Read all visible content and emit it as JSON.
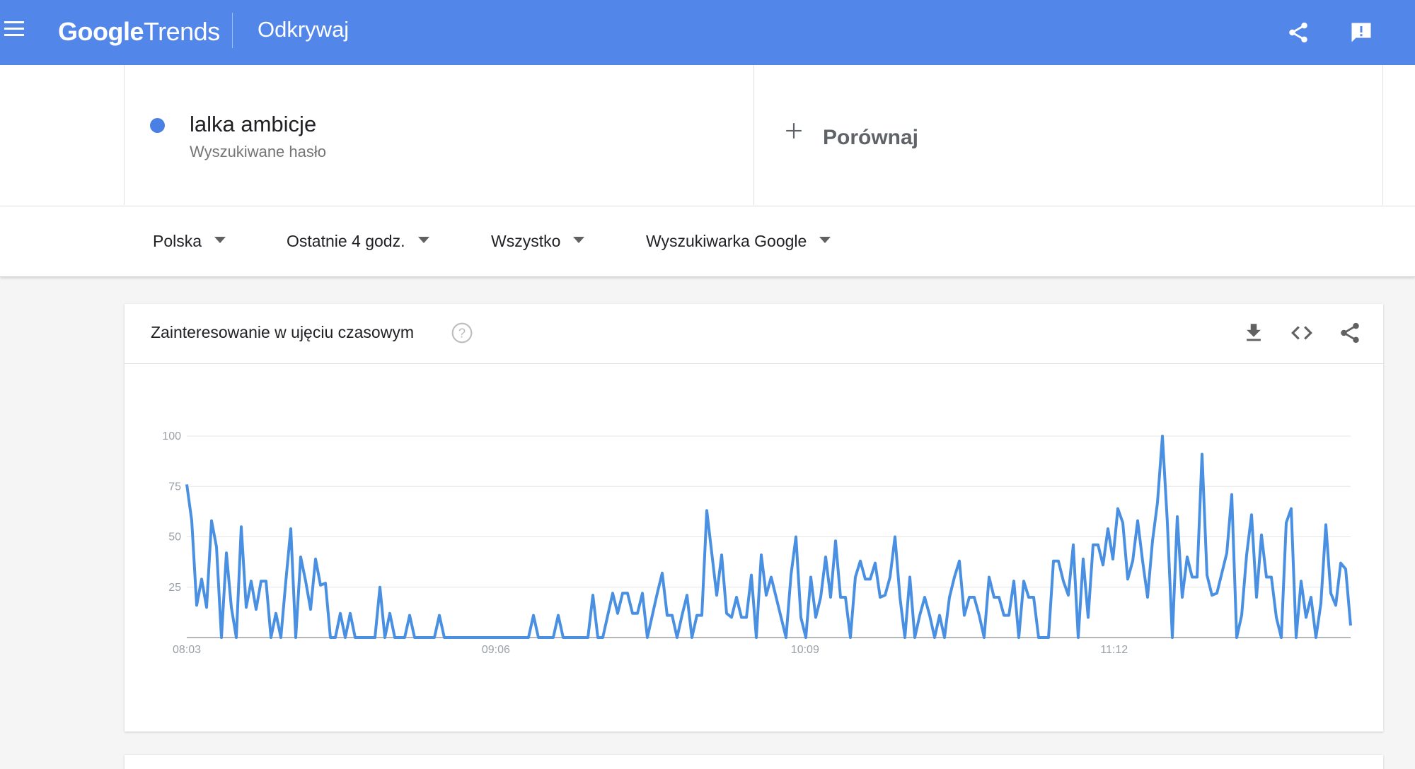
{
  "header": {
    "logo_google": "Google",
    "logo_trends": "Trends",
    "section": "Odkrywaj",
    "icons": [
      "menu-icon",
      "share-icon",
      "feedback-icon"
    ],
    "color": "#5287e9"
  },
  "term": {
    "name": "lalka ambicje",
    "type": "Wyszukiwane hasło",
    "color": "#4a7fe3"
  },
  "compare": {
    "label": "Porównaj"
  },
  "filters": {
    "region": "Polska",
    "time": "Ostatnie 4 godz.",
    "category": "Wszystko",
    "property": "Wyszukiwarka Google"
  },
  "chart_card": {
    "title": "Zainteresowanie w ujęciu czasowym",
    "tools": [
      "download-icon",
      "embed-code-icon",
      "share-icon"
    ]
  },
  "chart_data": {
    "type": "line",
    "x_labels": [
      "08:03",
      "09:06",
      "10:09",
      "11:12"
    ],
    "y_ticks": [
      25,
      50,
      75,
      100
    ],
    "ylim": [
      0,
      100
    ],
    "grid": true,
    "series": [
      {
        "color": "#4a90e2",
        "values": [
          76,
          58,
          16,
          29,
          15,
          58,
          45,
          0,
          42,
          15,
          0,
          55,
          15,
          28,
          14,
          28,
          28,
          0,
          12,
          0,
          28,
          54,
          0,
          40,
          28,
          14,
          39,
          26,
          27,
          0,
          0,
          12,
          0,
          12,
          0,
          0,
          0,
          0,
          0,
          25,
          0,
          12,
          0,
          0,
          0,
          11,
          0,
          0,
          0,
          0,
          0,
          11,
          0,
          0,
          0,
          0,
          0,
          0,
          0,
          0,
          0,
          0,
          0,
          0,
          0,
          0,
          0,
          0,
          0,
          0,
          11,
          0,
          0,
          0,
          0,
          11,
          0,
          0,
          0,
          0,
          0,
          0,
          21,
          0,
          0,
          11,
          22,
          12,
          22,
          22,
          12,
          12,
          22,
          0,
          11,
          22,
          32,
          11,
          11,
          0,
          11,
          21,
          0,
          11,
          11,
          63,
          42,
          21,
          41,
          12,
          10,
          20,
          10,
          10,
          31,
          0,
          41,
          21,
          30,
          20,
          10,
          0,
          31,
          50,
          10,
          0,
          30,
          10,
          20,
          40,
          20,
          48,
          20,
          20,
          0,
          30,
          38,
          29,
          29,
          37,
          20,
          21,
          30,
          50,
          20,
          0,
          30,
          0,
          11,
          20,
          11,
          0,
          11,
          0,
          20,
          30,
          38,
          11,
          20,
          20,
          11,
          0,
          30,
          20,
          20,
          11,
          11,
          28,
          0,
          28,
          20,
          20,
          0,
          0,
          0,
          38,
          38,
          28,
          21,
          46,
          0,
          39,
          10,
          46,
          46,
          36,
          54,
          39,
          64,
          57,
          29,
          38,
          58,
          38,
          20,
          48,
          67,
          100,
          57,
          0,
          60,
          20,
          40,
          30,
          30,
          91,
          31,
          21,
          22,
          32,
          42,
          71,
          0,
          11,
          41,
          61,
          20,
          51,
          30,
          30,
          10,
          0,
          57,
          64,
          0,
          28,
          10,
          20,
          0,
          17,
          56,
          22,
          16,
          37,
          34,
          6
        ]
      }
    ]
  }
}
